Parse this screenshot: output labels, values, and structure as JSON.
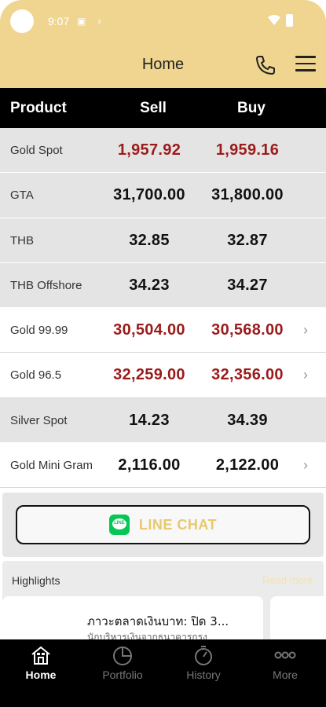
{
  "status_bar": {
    "time": "9:07"
  },
  "header": {
    "title": "Home"
  },
  "table": {
    "columns": [
      "Product",
      "Sell",
      "Buy"
    ],
    "rows": [
      {
        "name": "Gold Spot",
        "sell": "1,957.92",
        "buy": "1,959.16"
      },
      {
        "name": "GTA",
        "sell": "31,700.00",
        "buy": "31,800.00"
      },
      {
        "name": "THB",
        "sell": "32.85",
        "buy": "32.87"
      },
      {
        "name": "THB Offshore",
        "sell": "34.23",
        "buy": "34.27"
      },
      {
        "name": "Gold 99.99",
        "sell": "30,504.00",
        "buy": "30,568.00"
      },
      {
        "name": "Gold 96.5",
        "sell": "32,259.00",
        "buy": "32,356.00"
      },
      {
        "name": "Silver Spot",
        "sell": "14.23",
        "buy": "34.39"
      },
      {
        "name": "Gold Mini Gram",
        "sell": "2,116.00",
        "buy": "2,122.00"
      }
    ]
  },
  "line_chat": {
    "label": "LINE CHAT"
  },
  "highlights": {
    "title": "Highlights",
    "read_more": "Read more",
    "headline": "ภาวะตลาดเงินบาท: ปิด 3...",
    "sub": "นักบริหารเงินจากธนาคารกรุง"
  },
  "bottom_nav": [
    {
      "label": "Home",
      "active": true
    },
    {
      "label": "Portfolio",
      "active": false
    },
    {
      "label": "History",
      "active": false
    },
    {
      "label": "More",
      "active": false
    }
  ],
  "colors": {
    "header_bg": "#efd590",
    "price_red": "#9b1b1b",
    "line_green": "#06c755",
    "line_label": "#e8c96e"
  }
}
